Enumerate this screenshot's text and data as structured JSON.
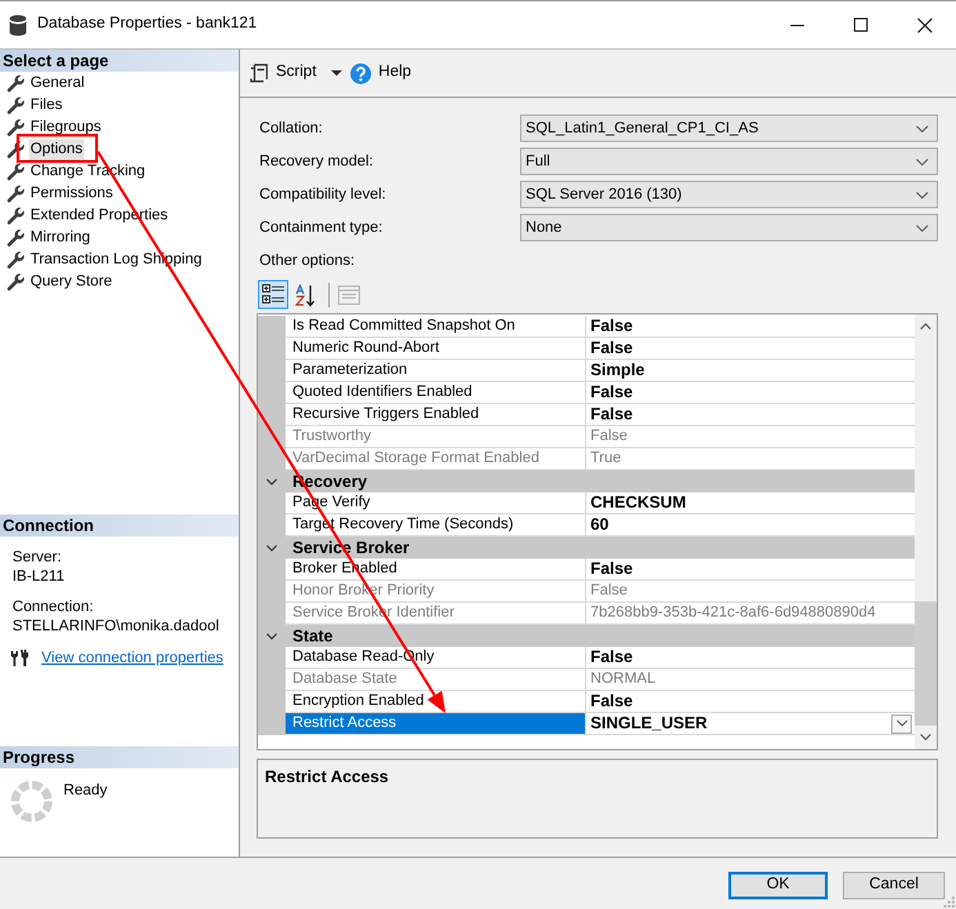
{
  "window": {
    "title": "Database Properties - bank121"
  },
  "sidebar": {
    "header": "Select a page",
    "pages": [
      {
        "label": "General",
        "selected": false
      },
      {
        "label": "Files",
        "selected": false
      },
      {
        "label": "Filegroups",
        "selected": false
      },
      {
        "label": "Options",
        "selected": true
      },
      {
        "label": "Change Tracking",
        "selected": false
      },
      {
        "label": "Permissions",
        "selected": false
      },
      {
        "label": "Extended Properties",
        "selected": false
      },
      {
        "label": "Mirroring",
        "selected": false
      },
      {
        "label": "Transaction Log Shipping",
        "selected": false
      },
      {
        "label": "Query Store",
        "selected": false
      }
    ]
  },
  "connection": {
    "header": "Connection",
    "fields": [
      {
        "label": "Server:",
        "value": "IB-L211"
      },
      {
        "label": "Connection:",
        "value": "STELLARINFO\\monika.dadool"
      }
    ],
    "link": "View connection properties"
  },
  "progress": {
    "header": "Progress",
    "status": "Ready"
  },
  "toolbar": {
    "script": "Script",
    "help": "Help"
  },
  "form": {
    "fields": [
      {
        "label": "Collation:",
        "value": "SQL_Latin1_General_CP1_CI_AS"
      },
      {
        "label": "Recovery model:",
        "value": "Full"
      },
      {
        "label": "Compatibility level:",
        "value": "SQL Server 2016 (130)"
      },
      {
        "label": "Containment type:",
        "value": "None"
      }
    ],
    "other_options": "Other options:"
  },
  "grid_view": [
    {
      "kind": "categorized",
      "selected": true
    },
    {
      "kind": "alphabetical",
      "selected": false
    }
  ],
  "property_pages": {
    "disabled": true
  },
  "property_grid": {
    "rows": [
      {
        "kind": "property",
        "name": "Is Read Committed Snapshot On",
        "value": "False",
        "disabled": false,
        "selected": false
      },
      {
        "kind": "property",
        "name": "Numeric Round-Abort",
        "value": "False",
        "disabled": false,
        "selected": false
      },
      {
        "kind": "property",
        "name": "Parameterization",
        "value": "Simple",
        "disabled": false,
        "selected": false
      },
      {
        "kind": "property",
        "name": "Quoted Identifiers Enabled",
        "value": "False",
        "disabled": false,
        "selected": false
      },
      {
        "kind": "property",
        "name": "Recursive Triggers Enabled",
        "value": "False",
        "disabled": false,
        "selected": false
      },
      {
        "kind": "property",
        "name": "Trustworthy",
        "value": "False",
        "disabled": true,
        "selected": false
      },
      {
        "kind": "property",
        "name": "VarDecimal Storage Format Enabled",
        "value": "True",
        "disabled": true,
        "selected": false
      },
      {
        "kind": "category",
        "name": "Recovery",
        "expanded": true
      },
      {
        "kind": "property",
        "name": "Page Verify",
        "value": "CHECKSUM",
        "disabled": false,
        "selected": false
      },
      {
        "kind": "property",
        "name": "Target Recovery Time (Seconds)",
        "value": "60",
        "disabled": false,
        "selected": false
      },
      {
        "kind": "category",
        "name": "Service Broker",
        "expanded": true
      },
      {
        "kind": "property",
        "name": "Broker Enabled",
        "value": "False",
        "disabled": false,
        "selected": false
      },
      {
        "kind": "property",
        "name": "Honor Broker Priority",
        "value": "False",
        "disabled": true,
        "selected": false
      },
      {
        "kind": "property",
        "name": "Service Broker Identifier",
        "value": "7b268bb9-353b-421c-8af6-6d94880890d4",
        "disabled": true,
        "selected": false
      },
      {
        "kind": "category",
        "name": "State",
        "expanded": true
      },
      {
        "kind": "property",
        "name": "Database Read-Only",
        "value": "False",
        "disabled": false,
        "selected": false
      },
      {
        "kind": "property",
        "name": "Database State",
        "value": "NORMAL",
        "disabled": true,
        "selected": false
      },
      {
        "kind": "property",
        "name": "Encryption Enabled",
        "value": "False",
        "disabled": false,
        "selected": false
      },
      {
        "kind": "property",
        "name": "Restrict Access",
        "value": "SINGLE_USER",
        "disabled": false,
        "selected": true
      }
    ]
  },
  "description": {
    "title": "Restrict Access"
  },
  "buttons": [
    {
      "label": "OK",
      "default": true
    },
    {
      "label": "Cancel",
      "default": false
    }
  ]
}
